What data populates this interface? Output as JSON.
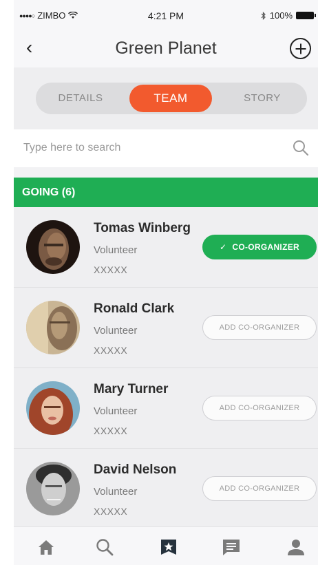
{
  "status_bar": {
    "carrier": "ZIMBO",
    "time": "4:21 PM",
    "battery": "100%"
  },
  "nav": {
    "title": "Green Planet",
    "back_icon": "chevron-left-icon",
    "add_icon": "plus-circle-icon"
  },
  "tabs": [
    {
      "label": "DETAILS",
      "active": false
    },
    {
      "label": "TEAM",
      "active": true
    },
    {
      "label": "STORY",
      "active": false
    }
  ],
  "search": {
    "placeholder": "Type here to search",
    "value": ""
  },
  "section": {
    "title": "GOING (6)"
  },
  "members": [
    {
      "name": "Tomas Winberg",
      "role": "Volunteer",
      "extra": "XXXXX",
      "button": "CO-ORGANIZER",
      "is_co_organizer": true
    },
    {
      "name": "Ronald Clark",
      "role": "Volunteer",
      "extra": "XXXXX",
      "button": "ADD CO-ORGANIZER",
      "is_co_organizer": false
    },
    {
      "name": "Mary Turner",
      "role": "Volunteer",
      "extra": "XXXXX",
      "button": "ADD CO-ORGANIZER",
      "is_co_organizer": false
    },
    {
      "name": "David Nelson",
      "role": "Volunteer",
      "extra": "XXXXX",
      "button": "ADD CO-ORGANIZER",
      "is_co_organizer": false
    }
  ],
  "tabbar": [
    {
      "icon": "home-icon",
      "active": false
    },
    {
      "icon": "search-icon",
      "active": false
    },
    {
      "icon": "star-badge-icon",
      "active": true
    },
    {
      "icon": "message-icon",
      "active": false
    },
    {
      "icon": "profile-icon",
      "active": false
    }
  ],
  "colors": {
    "accent_orange": "#f25a2e",
    "accent_green": "#1fae54",
    "background": "#f2f2f4"
  }
}
